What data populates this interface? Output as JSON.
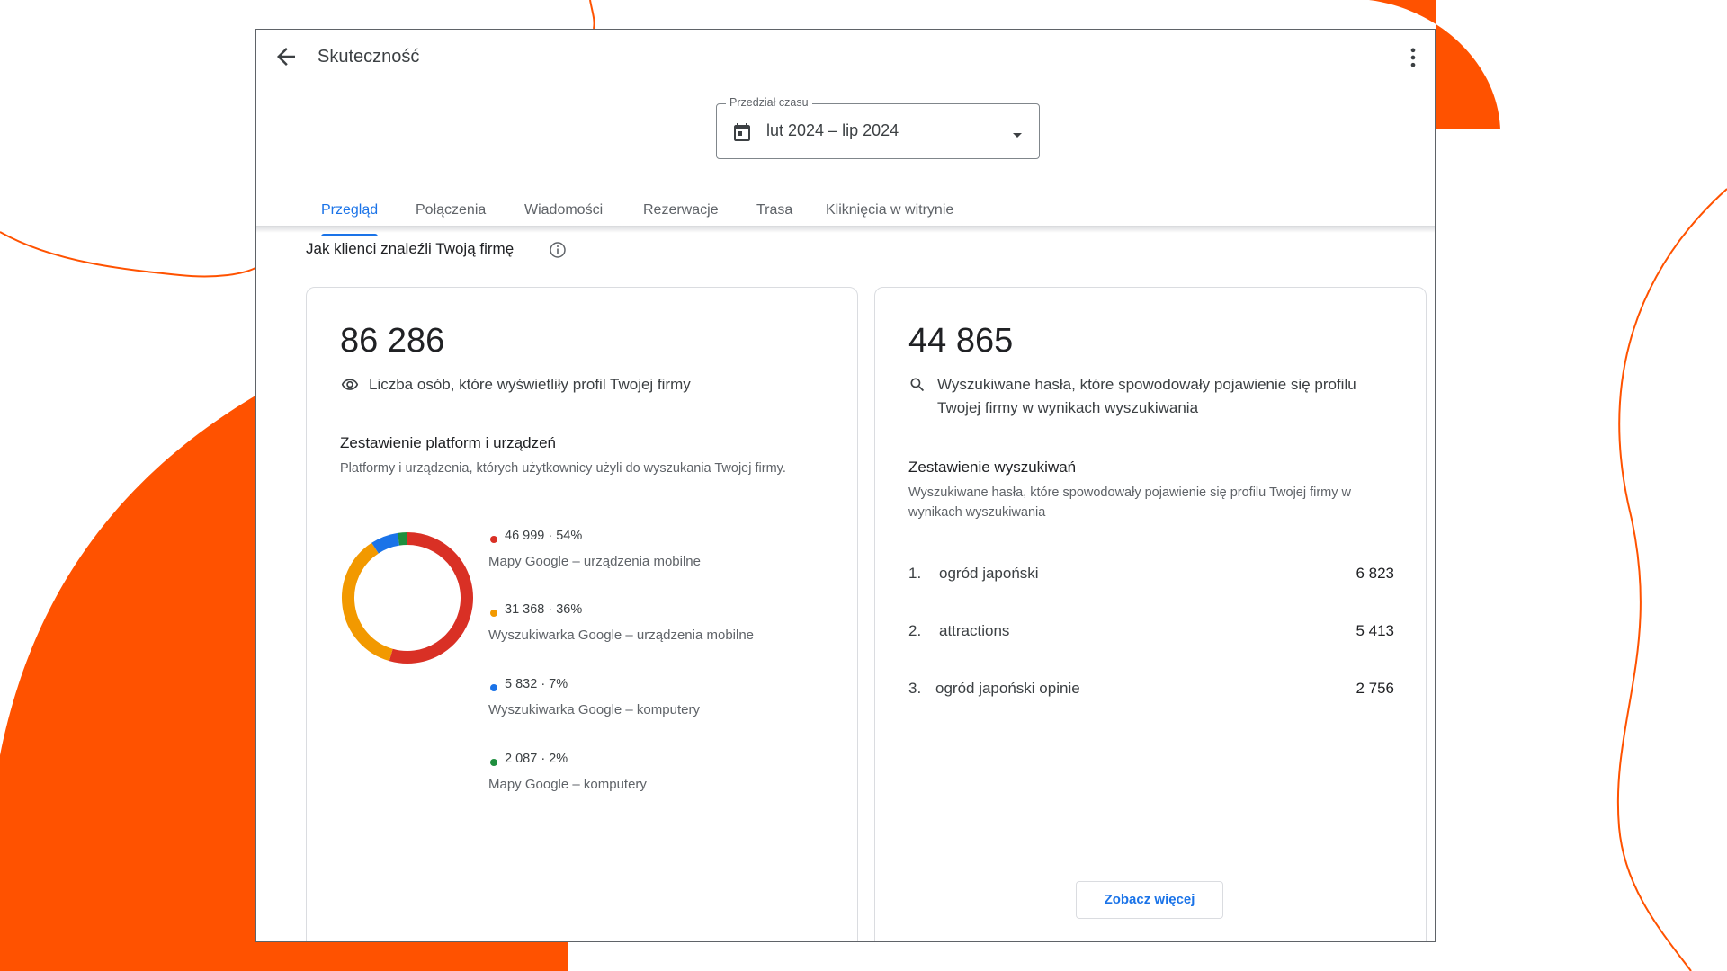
{
  "colors": {
    "accent_orange": "#ff5200",
    "link_blue": "#1a73e8",
    "series_red": "#d93025",
    "series_yellow": "#f29900",
    "series_blue": "#1a73e8",
    "series_green": "#1e8e3e"
  },
  "header": {
    "title": "Skuteczność",
    "back_icon": "arrow-back-icon",
    "menu_icon": "more-vert-icon"
  },
  "date_range": {
    "legend": "Przedział czasu",
    "value": "lut 2024 – lip 2024",
    "icon": "calendar-icon"
  },
  "tabs": [
    {
      "label": "Przegląd",
      "active": true
    },
    {
      "label": "Połączenia",
      "active": false
    },
    {
      "label": "Wiadomości",
      "active": false
    },
    {
      "label": "Rezerwacje",
      "active": false
    },
    {
      "label": "Trasa",
      "active": false
    },
    {
      "label": "Kliknięcia w witrynie",
      "active": false
    }
  ],
  "section": {
    "title": "Jak klienci znaleźli Twoją firmę",
    "icon": "info-icon"
  },
  "views_card": {
    "total": "86 286",
    "metric_label": "Liczba osób, które wyświetliły profil Twojej firmy",
    "metric_icon": "eye-icon",
    "breakdown_title": "Zestawienie platform i urządzeń",
    "breakdown_desc": "Platformy i urządzenia, których użytkownicy użyli do wyszukania Twojej firmy.",
    "legend": [
      {
        "value_text": "46 999 · 54%",
        "label": "Mapy Google – urządzenia mobilne"
      },
      {
        "value_text": "31 368 · 36%",
        "label": "Wyszukiwarka Google – urządzenia mobilne"
      },
      {
        "value_text": "5 832 · 7%",
        "label": "Wyszukiwarka Google – komputery"
      },
      {
        "value_text": "2 087 · 2%",
        "label": "Mapy Google – komputery"
      }
    ]
  },
  "chart_data": {
    "type": "pie",
    "categories": [
      "Mapy Google – urządzenia mobilne",
      "Wyszukiwarka Google – urządzenia mobilne",
      "Wyszukiwarka Google – komputery",
      "Mapy Google – komputery"
    ],
    "values": [
      46999,
      31368,
      5832,
      2087
    ],
    "colors": [
      "#d93025",
      "#f29900",
      "#1a73e8",
      "#1e8e3e"
    ]
  },
  "search_card": {
    "total": "44 865",
    "metric_label": "Wyszukiwane hasła, które spowodowały pojawienie się profilu Twojej firmy w wynikach wyszukiwania",
    "metric_icon": "search-icon",
    "breakdown_title": "Zestawienie wyszukiwań",
    "breakdown_desc": "Wyszukiwane hasła, które spowodowały pojawienie się profilu Twojej firmy w wynikach wyszukiwania",
    "rows": [
      {
        "rank": "1.",
        "term": "ogród japoński",
        "count": "6 823"
      },
      {
        "rank": "2.",
        "term": "attractions",
        "count": "5 413"
      },
      {
        "rank": "3.",
        "term": "ogród japoński opinie",
        "count": "2 756"
      }
    ],
    "see_more_label": "Zobacz więcej"
  }
}
